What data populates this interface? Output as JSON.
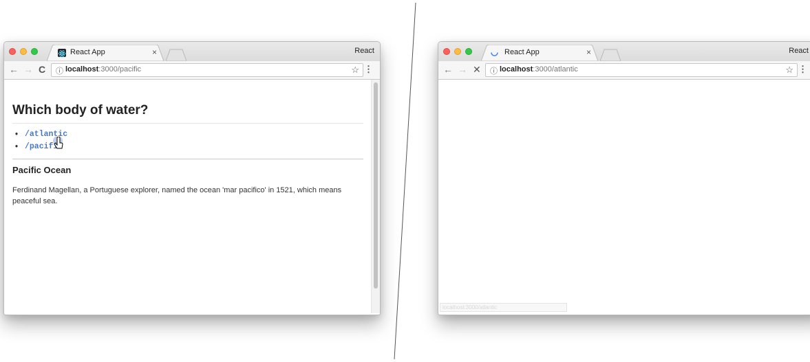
{
  "left_window": {
    "tab_title": "React App",
    "tab_close": "×",
    "profile": "React",
    "url_host": "localhost",
    "url_path": ":3000/pacific",
    "page": {
      "heading": "Which body of water?",
      "links": [
        "/atlantic",
        "/pacific"
      ],
      "section_title": "Pacific Ocean",
      "section_text": "Ferdinand Magellan, a Portuguese explorer, named the ocean 'mar pacifico' in 1521, which means peaceful sea."
    }
  },
  "right_window": {
    "tab_title": "React App",
    "tab_close": "×",
    "profile": "React",
    "url_host": "localhost",
    "url_path": ":3000/atlantic",
    "status_text": "localhost:3000/atlantic"
  },
  "icons": {
    "back": "←",
    "forward": "→",
    "reload": "C",
    "stop": "✕",
    "info": "ⓘ",
    "star": "☆",
    "menu": "⋮"
  }
}
